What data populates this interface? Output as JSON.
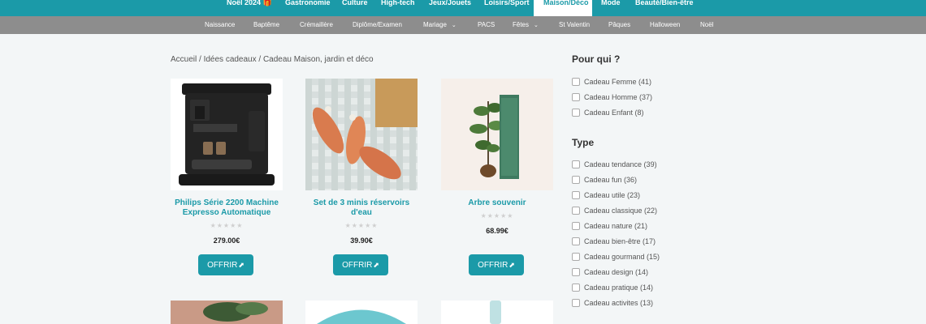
{
  "top_nav": {
    "items": [
      {
        "label": "Noël 2024 🎁"
      },
      {
        "label": "Gastronomie"
      },
      {
        "label": "Culture"
      },
      {
        "label": "High-tech"
      },
      {
        "label": "Jeux/Jouets"
      },
      {
        "label": "Loisirs/Sport"
      },
      {
        "label": "Maison/Déco",
        "active": true
      },
      {
        "label": "Mode"
      },
      {
        "label": "Beauté/Bien-être"
      }
    ]
  },
  "sub_nav": {
    "items": [
      {
        "label": "Naissance"
      },
      {
        "label": "Baptême"
      },
      {
        "label": "Crémaillère"
      },
      {
        "label": "Diplôme/Examen"
      },
      {
        "label": "Mariage",
        "has_dropdown": true
      },
      {
        "label": "PACS"
      },
      {
        "label": "Fêtes",
        "has_dropdown": true
      },
      {
        "label": "St Valentin"
      },
      {
        "label": "Pâques"
      },
      {
        "label": "Halloween"
      },
      {
        "label": "Noël"
      }
    ]
  },
  "breadcrumb": "Accueil / Idées cadeaux / Cadeau Maison, jardin et déco",
  "products": [
    {
      "title": "Philips Série 2200 Machine Expresso Automatique",
      "stars": "★★★★★",
      "price": "279.00€",
      "button": "OFFRIR"
    },
    {
      "title": "Set de 3 minis réservoirs d'eau",
      "stars": "★★★★★",
      "price": "39.90€",
      "button": "OFFRIR"
    },
    {
      "title": "Arbre souvenir",
      "stars": "★★★★★",
      "price": "68.99€",
      "button": "OFFRIR"
    }
  ],
  "sidebar": {
    "pour_qui": {
      "heading": "Pour qui ?",
      "options": [
        "Cadeau Femme (41)",
        "Cadeau Homme (37)",
        "Cadeau Enfant (8)"
      ]
    },
    "type": {
      "heading": "Type",
      "options": [
        "Cadeau tendance (39)",
        "Cadeau fun (36)",
        "Cadeau utile (23)",
        "Cadeau classique (22)",
        "Cadeau nature (21)",
        "Cadeau bien-être (17)",
        "Cadeau gourmand (15)",
        "Cadeau design (14)",
        "Cadeau pratique (14)",
        "Cadeau activites (13)"
      ]
    }
  },
  "colors": {
    "accent": "#1b9aa8",
    "subnav_bg": "#8d8d8d",
    "page_bg": "#f3f6f7"
  },
  "icons": {
    "external_link": "external-link-icon",
    "dropdown": "chevron-down-icon"
  }
}
